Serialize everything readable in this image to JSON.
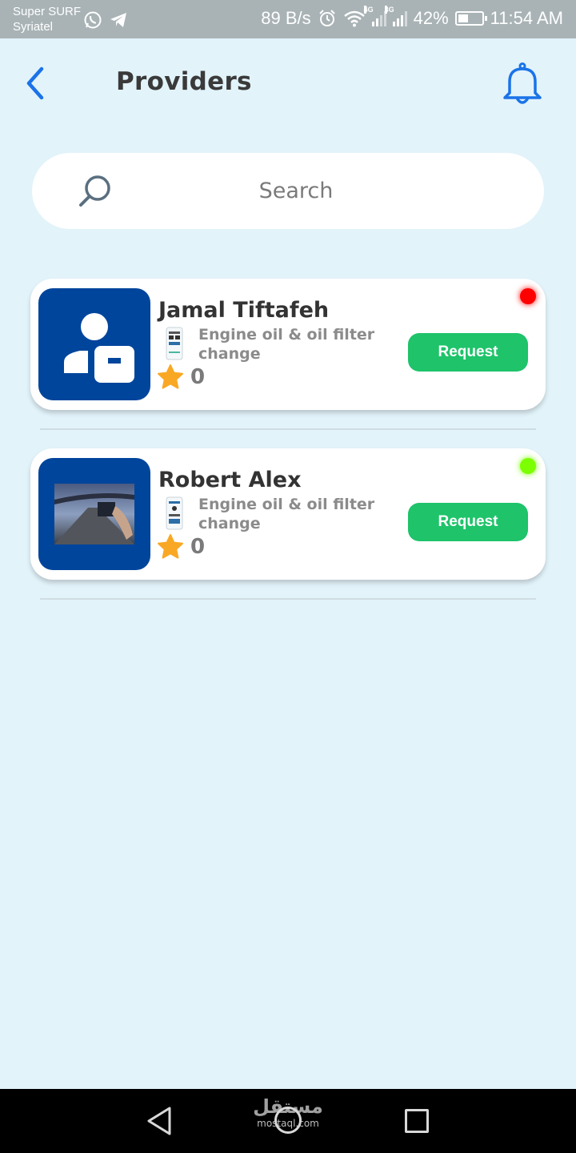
{
  "status_bar": {
    "carrier_line1": "Super SURF",
    "carrier_line2": "Syriatel",
    "net_speed": "89 B/s",
    "signal1_label": "4G",
    "signal2_label": "3G",
    "battery": "42%",
    "battery_level": 0.42,
    "time": "11:54 AM"
  },
  "header": {
    "title": "Providers",
    "back_icon": "chevron-left-icon",
    "notification_icon": "bell-icon"
  },
  "search": {
    "placeholder": "Search",
    "icon": "search-icon"
  },
  "providers": [
    {
      "name": "Jamal Tiftafeh",
      "service": "Engine oil & oil filter change",
      "rating": "0",
      "button_label": "Request",
      "status_color": "#ff0000",
      "avatar": "default-user-icon"
    },
    {
      "name": "Robert Alex",
      "service": "Engine oil & oil filter change",
      "rating": "0",
      "button_label": "Request",
      "status_color": "#7cff00",
      "avatar": "photo"
    }
  ],
  "nav_bar": {
    "watermark_ar": "مستقل",
    "watermark_en": "mostaql.com"
  },
  "colors": {
    "background": "#e2f3fa",
    "accent": "#1a73e8",
    "button": "#1ec36a",
    "avatar_bg": "#00459c"
  }
}
